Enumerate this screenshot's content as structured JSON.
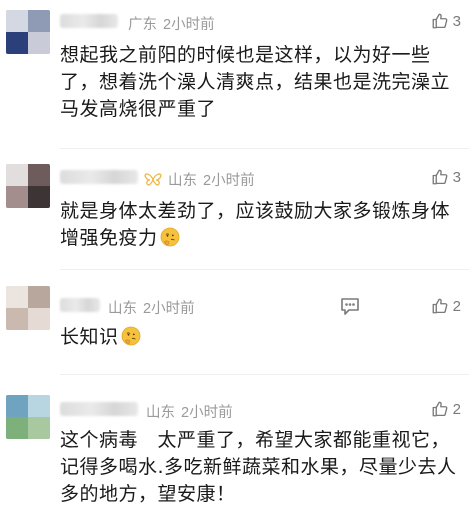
{
  "comments": [
    {
      "location": "广东",
      "time": "2小时前",
      "likes": "3",
      "text_lines": [
        "想起我之前阳的时候也是这样，以为好一些",
        "了，想着洗个澡人清爽点，结果也是洗完澡立",
        "马发高烧很严重了"
      ]
    },
    {
      "location": "山东",
      "time": "2小时前",
      "likes": "3",
      "text_lines": [
        "就是身体太差劲了，应该鼓励大家多锻炼身体",
        "增强免疫力"
      ],
      "emoji": "thinking-face"
    },
    {
      "location": "山东",
      "time": "2小时前",
      "likes": "2",
      "text_lines": [
        "长知识"
      ],
      "emoji": "thinking-face"
    },
    {
      "location": "山东",
      "time": "2小时前",
      "likes": "2",
      "text_lines": [
        "这个病毒　太严重了，希望大家都能重视它，",
        "记得多喝水.多吃新鲜蔬菜和水果，尽量少去人",
        "多的地方，望安康！"
      ]
    }
  ],
  "icons": {
    "like": "thumbs-up-icon",
    "reply": "comment-bubble-icon",
    "badge": "butterfly-badge-icon",
    "emoji": "thinking-face-icon"
  },
  "colors": {
    "meta_text": "#9a9a9a",
    "body_text": "#1a1a1a",
    "icon": "#7a7a7a",
    "badge": "#f0b84a"
  }
}
